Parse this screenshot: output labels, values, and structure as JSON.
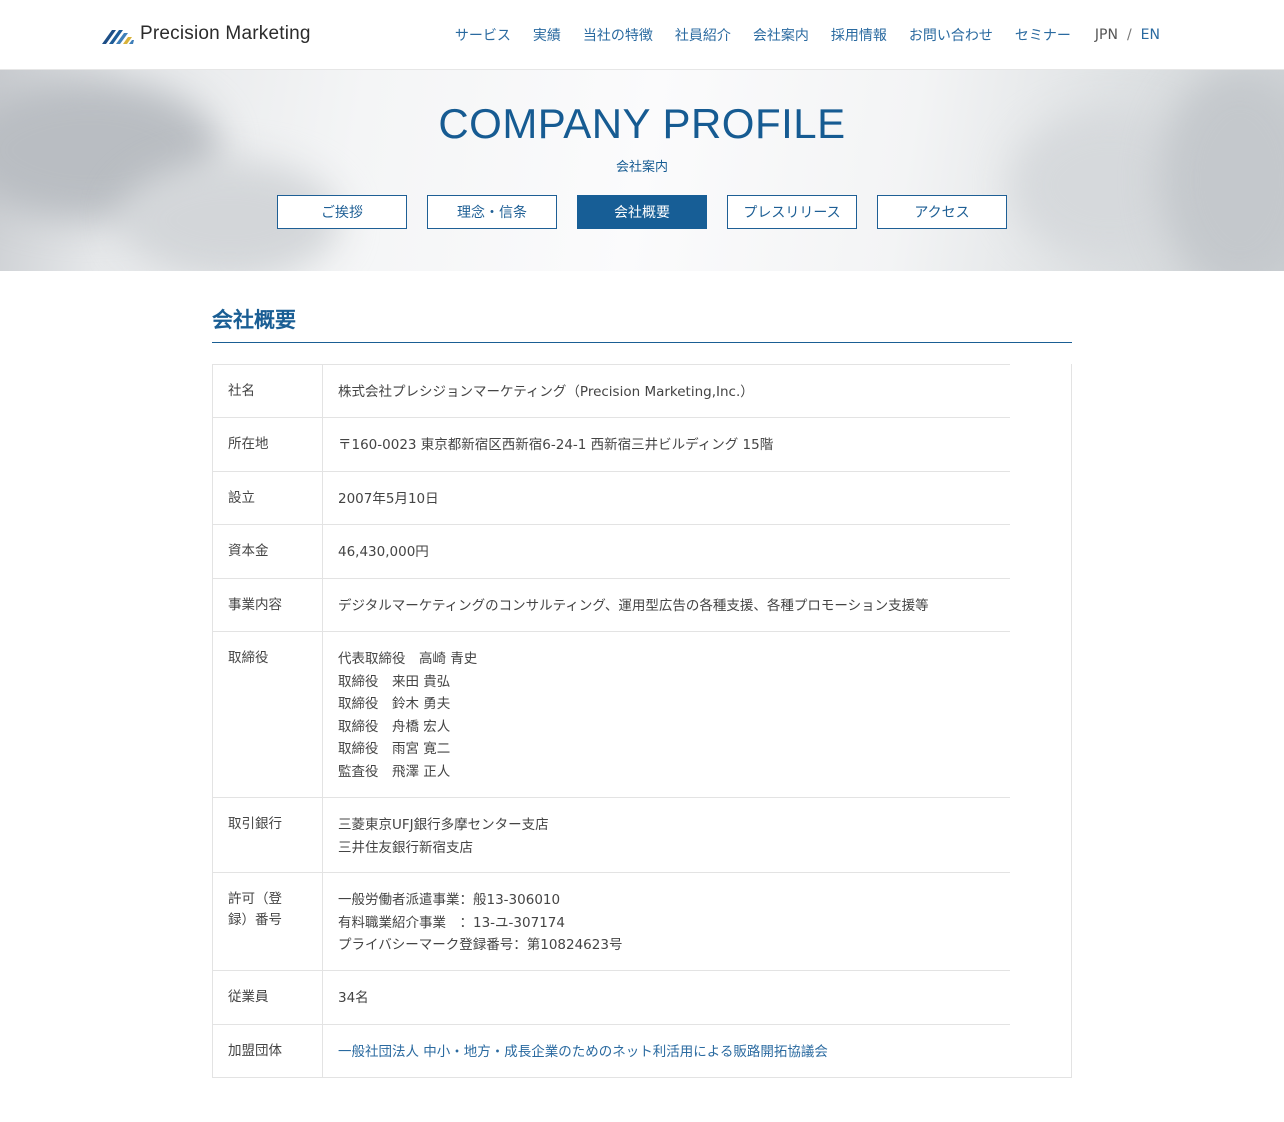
{
  "header": {
    "logo_text": "Precision Marketing",
    "nav": [
      "サービス",
      "実績",
      "当社の特徴",
      "社員紹介",
      "会社案内",
      "採用情報",
      "お問い合わせ",
      "セミナー"
    ],
    "lang": {
      "jpn": "JPN",
      "sep": "/",
      "en": "EN"
    }
  },
  "hero": {
    "title": "COMPANY PROFILE",
    "subtitle": "会社案内",
    "tabs": [
      "ご挨拶",
      "理念・信条",
      "会社概要",
      "プレスリリース",
      "アクセス"
    ],
    "active_tab": "会社概要"
  },
  "section": {
    "title": "会社概要"
  },
  "profile": {
    "rows": [
      {
        "label": "社名",
        "lines": [
          "株式会社プレシジョンマーケティング（Precision Marketing,Inc.）"
        ]
      },
      {
        "label": "所在地",
        "lines": [
          "〒160-0023 東京都新宿区西新宿6-24-1 西新宿三井ビルディング 15階"
        ]
      },
      {
        "label": "設立",
        "lines": [
          "2007年5月10日"
        ]
      },
      {
        "label": "資本金",
        "lines": [
          "46,430,000円"
        ]
      },
      {
        "label": "事業内容",
        "lines": [
          "デジタルマーケティングのコンサルティング、運用型広告の各種支援、各種プロモーション支援等"
        ]
      },
      {
        "label": "取締役",
        "lines": [
          "代表取締役　高崎 青史",
          "取締役　来田 貴弘",
          "取締役　鈴木 勇夫",
          "取締役　舟橋 宏人",
          "取締役　雨宮 寛二",
          "監査役　飛澤 正人"
        ]
      },
      {
        "label": "取引銀行",
        "lines": [
          "三菱東京UFJ銀行多摩センター支店",
          "三井住友銀行新宿支店"
        ]
      },
      {
        "label": "許可（登録）番号",
        "label_lines": [
          "許可（登",
          "録）番号"
        ],
        "lines": [
          "一般労働者派遣事業：般13-306010",
          "有料職業紹介事業　：13-ユ-307174",
          "プライバシーマーク登録番号：第10824623号"
        ]
      },
      {
        "label": "従業員",
        "lines": [
          "34名"
        ]
      },
      {
        "label": "加盟団体",
        "lines": [
          "一般社団法人 中小・地方・成長企業のためのネット利活用による販路開拓協議会"
        ],
        "link": true
      }
    ]
  },
  "colors": {
    "brand": "#1a5e94",
    "link": "#2a6aa0",
    "text": "#444444",
    "border": "#e3e3e3"
  }
}
